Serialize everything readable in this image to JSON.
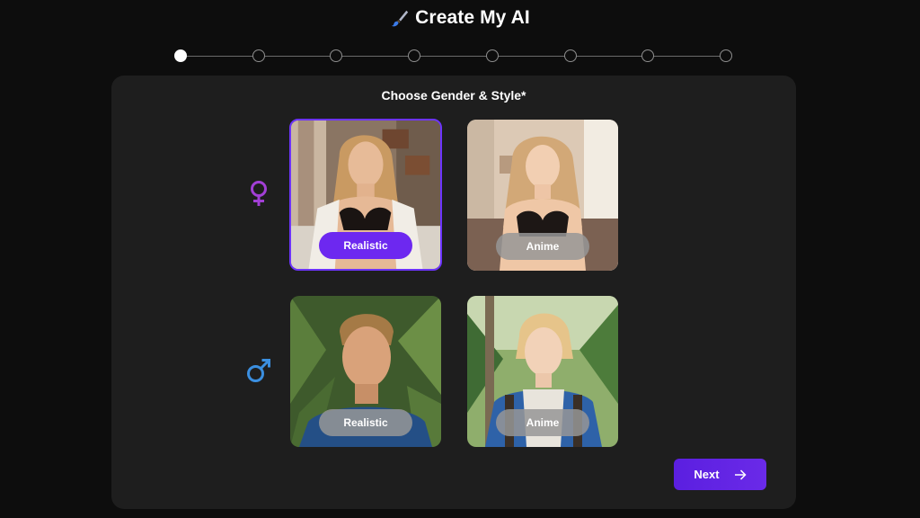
{
  "header": {
    "title": "Create My AI",
    "icon": "paintbrush-icon"
  },
  "stepper": {
    "total_steps": 8,
    "current_step": 1
  },
  "panel": {
    "subtitle": "Choose Gender & Style*"
  },
  "genders": [
    {
      "name": "female",
      "icon": "female-symbol-icon",
      "color": "#a23fd6"
    },
    {
      "name": "male",
      "icon": "male-symbol-icon",
      "color": "#3b8fe0"
    }
  ],
  "cards": {
    "female_realistic": {
      "label": "Realistic",
      "selected": true
    },
    "female_anime": {
      "label": "Anime",
      "selected": false
    },
    "male_realistic": {
      "label": "Realistic",
      "selected": false
    },
    "male_anime": {
      "label": "Anime",
      "selected": false
    }
  },
  "next_button": {
    "label": "Next",
    "icon": "arrow-right-icon"
  },
  "colors": {
    "accent": "#6d34ff",
    "background": "#0d0d0d",
    "panel": "#1e1e1e"
  }
}
